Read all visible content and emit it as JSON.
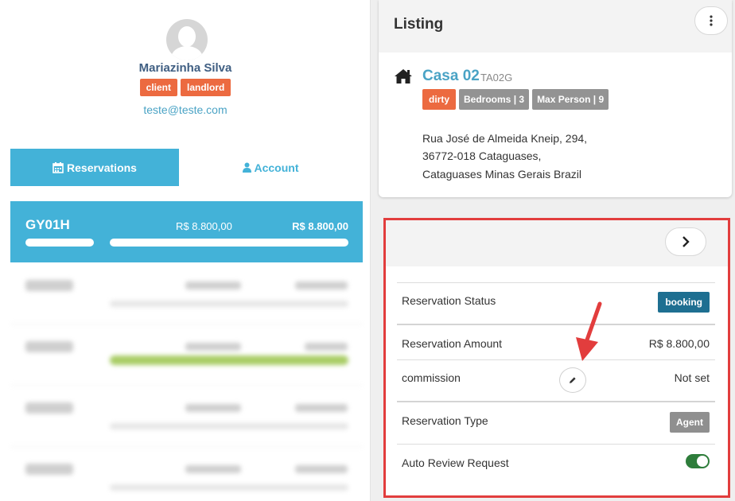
{
  "profile": {
    "name": "Mariazinha Silva",
    "roles": [
      "client",
      "landlord"
    ],
    "email": "teste@teste.com"
  },
  "tabs": {
    "reservations_label": "Reservations",
    "account_label": "Account"
  },
  "selected_reservation": {
    "code": "GY01H",
    "amount": "R$ 8.800,00",
    "total": "R$ 8.800,00"
  },
  "listing": {
    "header_title": "Listing",
    "property_name": "Casa 02",
    "property_code": "TA02G",
    "badges": {
      "status": "dirty",
      "bedrooms": "Bedrooms | 3",
      "max_person": "Max Person | 9"
    },
    "address_lines": [
      "Rua José de Almeida Kneip, 294,",
      "36772-018 Cataguases,",
      "Cataguases Minas Gerais Brazil"
    ]
  },
  "reservation_details": {
    "status_label": "Reservation Status",
    "status_value": "booking",
    "amount_label": "Reservation Amount",
    "amount_value": "R$ 8.800,00",
    "commission_label": "commission",
    "commission_value": "Not set",
    "type_label": "Reservation Type",
    "type_value": "Agent",
    "auto_review_label": "Auto Review Request",
    "auto_review_enabled": true
  },
  "colors": {
    "primary": "#43b2d8",
    "accent_orange": "#ec6a40",
    "status_blue": "#1e6f91",
    "toggle_green": "#2e7d3b",
    "highlight_red": "#e23d3d"
  }
}
